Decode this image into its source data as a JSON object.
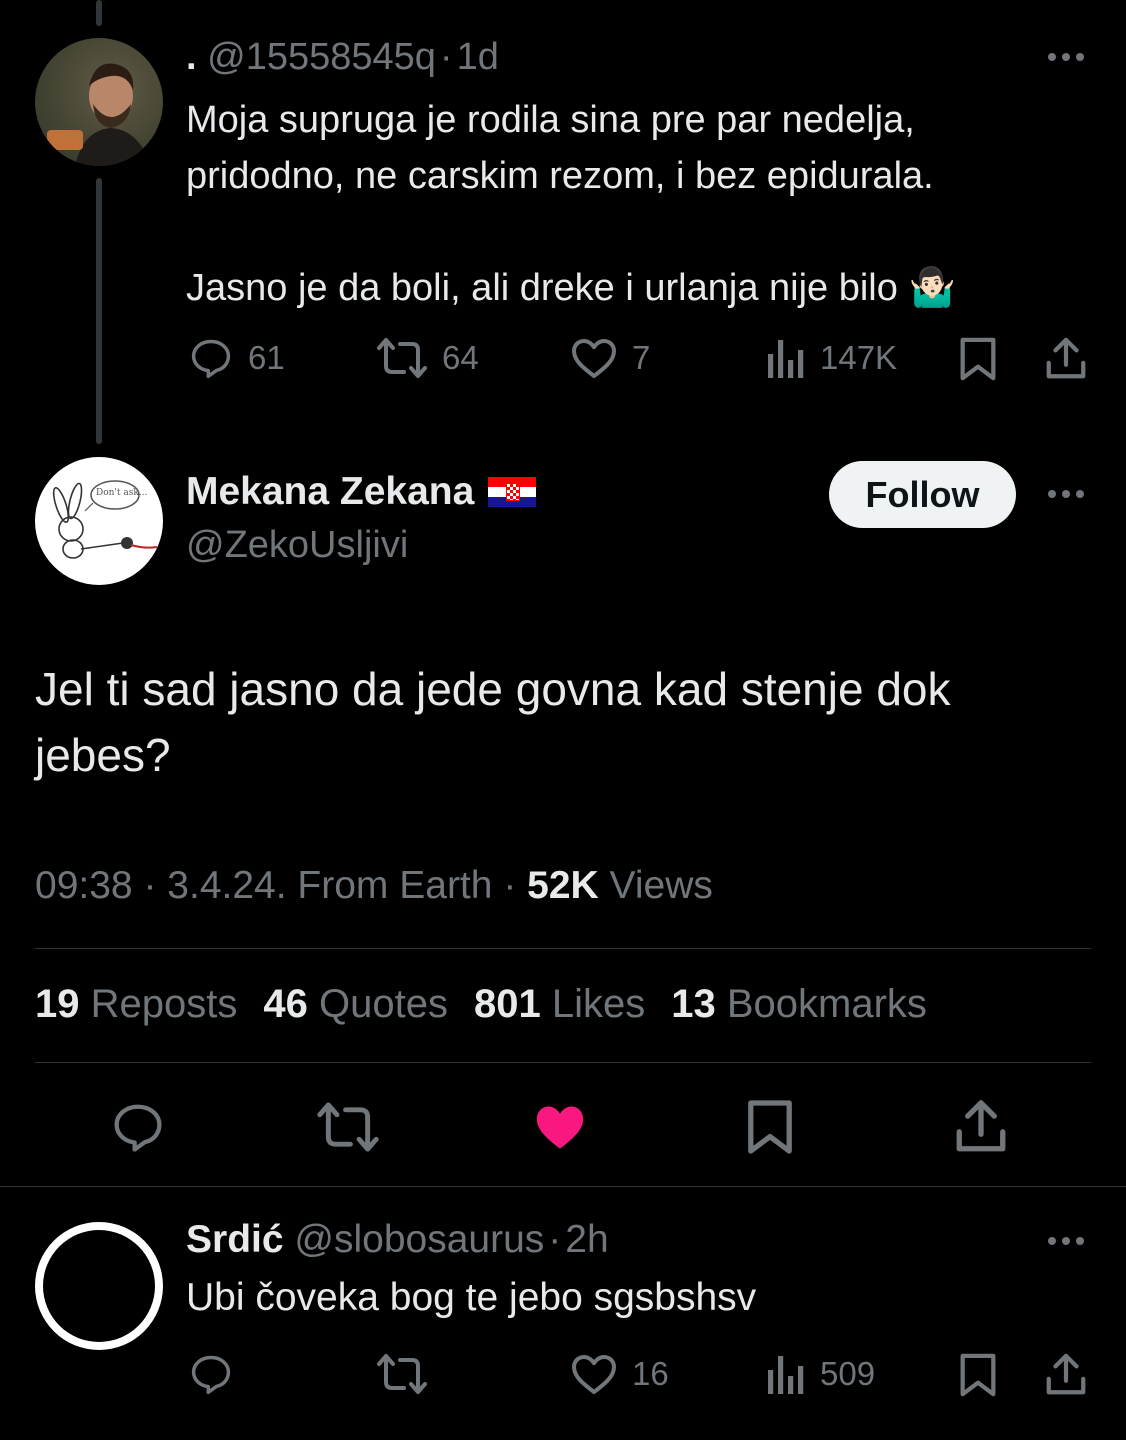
{
  "parent_tweet": {
    "name": ".",
    "handle": "@15558545q",
    "separator": "·",
    "time": "1d",
    "text_line1": "Moja supruga je rodila sina pre par nedelja,",
    "text_line2": "pridodno, ne carskim rezom, i bez epidurala.",
    "text_line3": "Jasno je da boli, ali dreke i urlanja nije bilo",
    "emoji": "🤷🏻‍♂️",
    "replies": "61",
    "reposts": "64",
    "likes": "7",
    "views": "147K"
  },
  "main_tweet": {
    "name": "Mekana Zekana",
    "flag": "🇭🇷",
    "handle": "@ZekoUsljivi",
    "follow_label": "Follow",
    "avatar_bubble_text": "Don't ask...",
    "text": "Jel ti sad jasno da jede govna kad stenje dok jebes?",
    "time": "09:38",
    "sep1": "·",
    "date": "3.4.24.",
    "source": "From Earth",
    "sep2": "·",
    "views_count": "52K",
    "views_label": "Views",
    "stats": [
      {
        "count": "19",
        "label": "Reposts"
      },
      {
        "count": "46",
        "label": "Quotes"
      },
      {
        "count": "801",
        "label": "Likes"
      },
      {
        "count": "13",
        "label": "Bookmarks"
      }
    ]
  },
  "reply_tweet": {
    "name": "Srdić",
    "handle": "@slobosaurus",
    "separator": "·",
    "time": "2h",
    "text": "Ubi čoveka bog te jebo sgsbshsv",
    "likes": "16",
    "views": "509"
  },
  "colors": {
    "background": "#000000",
    "text": "#e7e9ea",
    "muted": "#71767b",
    "like_active": "#f91880",
    "divider": "#2f3336"
  }
}
